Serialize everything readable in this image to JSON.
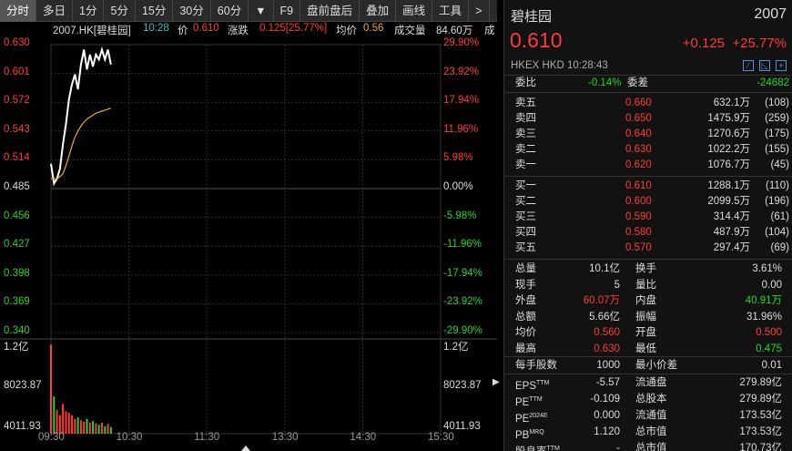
{
  "toolbar": {
    "items": [
      "分时",
      "多日",
      "1分",
      "5分",
      "15分",
      "30分",
      "60分",
      "▼",
      "F9",
      "盘前盘后",
      "叠加",
      "画线",
      "工具",
      ">"
    ]
  },
  "info": {
    "code": "2007.HK[碧桂园]",
    "time": "10:28",
    "price_label": "价",
    "price": "0.610",
    "chg_label": "涨跌",
    "chg": "0.125[25.77%]",
    "avg_label": "均价",
    "avg": "0.56",
    "vol_label": "成交量",
    "vol": "84.60万",
    "more": "成"
  },
  "left_axis": [
    "0.630",
    "0.601",
    "0.572",
    "0.543",
    "0.514",
    "0.485",
    "0.456",
    "0.427",
    "0.398",
    "0.369",
    "0.340"
  ],
  "right_axis": [
    "29.90%",
    "23.92%",
    "17.94%",
    "11.96%",
    "5.98%",
    "0.00%",
    "-5.98%",
    "-11.96%",
    "-17.94%",
    "-23.92%",
    "-29.90%"
  ],
  "vol_axis": [
    "1.2亿",
    "8023.87",
    "4011.93"
  ],
  "time_axis": [
    "09:30",
    "10:30",
    "11:30",
    "13:30",
    "14:30",
    "15:30"
  ],
  "chart_data": {
    "type": "line",
    "title": "2007.HK[碧桂园]",
    "prev_close": 0.485,
    "ylim": [
      0.34,
      0.63
    ],
    "x": [
      "09:30",
      "09:33",
      "09:36",
      "09:39",
      "09:42",
      "09:45",
      "09:48",
      "09:51",
      "09:54",
      "09:57",
      "10:00",
      "10:03",
      "10:06",
      "10:09",
      "10:12",
      "10:15",
      "10:18",
      "10:21",
      "10:24",
      "10:27",
      "10:28"
    ],
    "series": [
      {
        "values": [
          0.51,
          0.49,
          0.495,
          0.505,
          0.53,
          0.55,
          0.575,
          0.59,
          0.6,
          0.585,
          0.61,
          0.625,
          0.605,
          0.62,
          0.608,
          0.62,
          0.615,
          0.625,
          0.615,
          0.625,
          0.61
        ]
      },
      {
        "values": [
          0.495,
          0.495,
          0.495,
          0.497,
          0.5,
          0.508,
          0.518,
          0.528,
          0.537,
          0.543,
          0.548,
          0.552,
          0.555,
          0.557,
          0.559,
          0.561,
          0.562,
          0.563,
          0.564,
          0.565,
          0.566
        ]
      }
    ],
    "volume_ylim": [
      0,
      12000
    ],
    "volume": [
      12000,
      5000,
      3200,
      2500,
      4000,
      3000,
      2800,
      2500,
      2000,
      2200,
      1800,
      1600,
      2000,
      1500,
      1700,
      1400,
      1200,
      1500,
      1000,
      1300,
      900
    ]
  },
  "right": {
    "name": "碧桂园",
    "code": "2007",
    "price": "0.610",
    "chg": "+0.125",
    "pct": "+25.77%",
    "meta": "HKEX  HKD  10:28:43",
    "wb_label": "委比",
    "wb": "-0.14%",
    "wc_label": "委差",
    "wc": "-24682",
    "asks": [
      {
        "l": "卖五",
        "p": "0.660",
        "v": "632.1万",
        "n": "(108)"
      },
      {
        "l": "卖四",
        "p": "0.650",
        "v": "1475.9万",
        "n": "(259)"
      },
      {
        "l": "卖三",
        "p": "0.640",
        "v": "1270.6万",
        "n": "(175)"
      },
      {
        "l": "卖二",
        "p": "0.630",
        "v": "1022.2万",
        "n": "(155)"
      },
      {
        "l": "卖一",
        "p": "0.620",
        "v": "1076.7万",
        "n": "(45)"
      }
    ],
    "bids": [
      {
        "l": "买一",
        "p": "0.610",
        "v": "1288.1万",
        "n": "(110)"
      },
      {
        "l": "买二",
        "p": "0.600",
        "v": "2099.5万",
        "n": "(196)"
      },
      {
        "l": "买三",
        "p": "0.590",
        "v": "314.4万",
        "n": "(61)"
      },
      {
        "l": "买四",
        "p": "0.580",
        "v": "487.9万",
        "n": "(104)"
      },
      {
        "l": "买五",
        "p": "0.570",
        "v": "297.4万",
        "n": "(69)"
      }
    ],
    "stats": [
      {
        "a": "总量",
        "av": "10.1亿",
        "b": "换手",
        "bv": "3.61%"
      },
      {
        "a": "现手",
        "av": "5",
        "b": "量比",
        "bv": "0.00"
      },
      {
        "a": "外盘",
        "av": "60.07万",
        "b": "内盘",
        "bv": "40.91万"
      },
      {
        "a": "总额",
        "av": "5.66亿",
        "b": "振幅",
        "bv": "31.96%"
      },
      {
        "a": "均价",
        "av": "0.560",
        "b": "开盘",
        "bv": "0.500"
      },
      {
        "a": "最高",
        "av": "0.630",
        "b": "最低",
        "bv": "0.475"
      }
    ],
    "lot": {
      "a": "每手股数",
      "av": "1000",
      "b": "最小价差",
      "bv": "0.01"
    },
    "fund": [
      {
        "a": "EPS",
        "sup": "TTM",
        "av": "-5.57",
        "b": "流通盘",
        "bv": "279.89亿"
      },
      {
        "a": "PE",
        "sup": "TTM",
        "av": "-0.109",
        "b": "总股本",
        "bv": "279.89亿"
      },
      {
        "a": "PE",
        "sup": "2024E",
        "av": "0.000",
        "b": "流通值",
        "bv": "173.53亿"
      },
      {
        "a": "PB",
        "sup": "MRQ",
        "av": "1.120",
        "b": "总市值",
        "bv": "173.53亿"
      },
      {
        "a": "股息率",
        "sup": "TTM",
        "av": "-",
        "b": "总市值",
        "bv": "170.73亿"
      }
    ]
  }
}
